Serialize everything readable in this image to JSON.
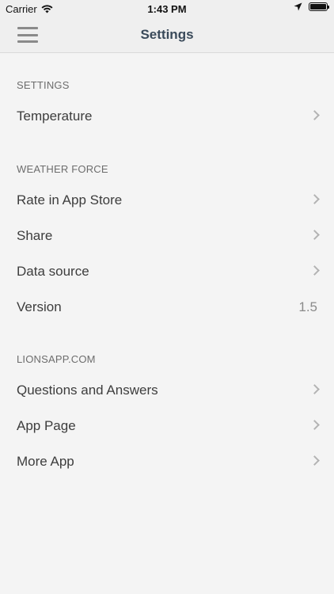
{
  "status_bar": {
    "carrier": "Carrier",
    "time": "1:43 PM"
  },
  "nav": {
    "title": "Settings"
  },
  "sections": [
    {
      "header": "SETTINGS",
      "rows": [
        {
          "label": "Temperature",
          "accessory": "chevron"
        }
      ]
    },
    {
      "header": "WEATHER FORCE",
      "rows": [
        {
          "label": "Rate in App Store",
          "accessory": "chevron"
        },
        {
          "label": "Share",
          "accessory": "chevron"
        },
        {
          "label": "Data source",
          "accessory": "chevron"
        },
        {
          "label": "Version",
          "value": "1.5"
        }
      ]
    },
    {
      "header": "LIONSAPP.COM",
      "rows": [
        {
          "label": "Questions and Answers",
          "accessory": "chevron"
        },
        {
          "label": "App Page",
          "accessory": "chevron"
        },
        {
          "label": "More App",
          "accessory": "chevron"
        }
      ]
    }
  ]
}
